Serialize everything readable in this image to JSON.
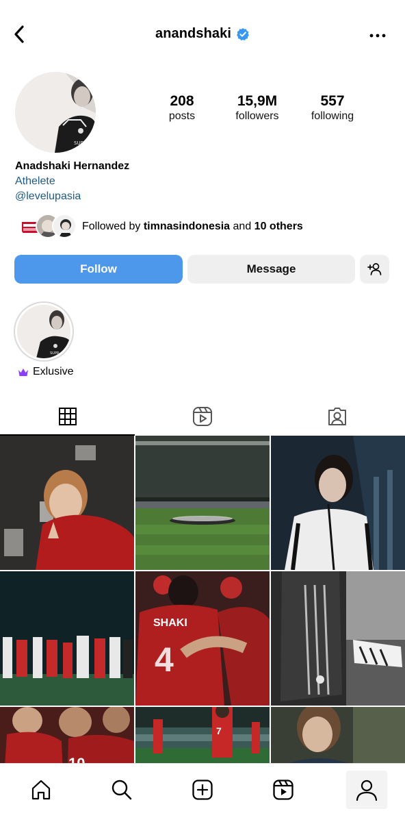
{
  "header": {
    "username": "anandshaki",
    "verified_icon": "verified-badge-icon",
    "back_icon": "chevron-left-icon",
    "more_icon": "more-horizontal-icon"
  },
  "stats": {
    "posts_count": "208",
    "posts_label": "posts",
    "followers_count": "15,9M",
    "followers_label": "followers",
    "following_count": "557",
    "following_label": "following"
  },
  "bio": {
    "name": "Anadshaki Hernandez",
    "category": "Athelete",
    "link": "@levelupasia"
  },
  "followed_by": {
    "prefix": "Followed by ",
    "account": "timnasindonesia",
    "middle": " and ",
    "others": "10 others"
  },
  "actions": {
    "follow_label": "Follow",
    "message_label": "Message",
    "add_icon": "add-person-icon"
  },
  "highlights": [
    {
      "label": "Exlusive",
      "icon": "crown-icon"
    }
  ],
  "tabs": [
    {
      "name": "grid",
      "icon": "grid-icon",
      "active": true
    },
    {
      "name": "reels",
      "icon": "reels-icon",
      "active": false
    },
    {
      "name": "tagged",
      "icon": "tagged-user-icon",
      "active": false
    }
  ],
  "bottom_nav": [
    {
      "icon": "home-icon"
    },
    {
      "icon": "search-icon"
    },
    {
      "icon": "create-plus-icon"
    },
    {
      "icon": "reels-icon"
    },
    {
      "icon": "profile-icon",
      "active": true
    }
  ],
  "colors": {
    "follow_button": "#4e98ec",
    "link_text": "#1d5a87",
    "verified": "#3897f0",
    "crown": "#8a3ffc"
  }
}
